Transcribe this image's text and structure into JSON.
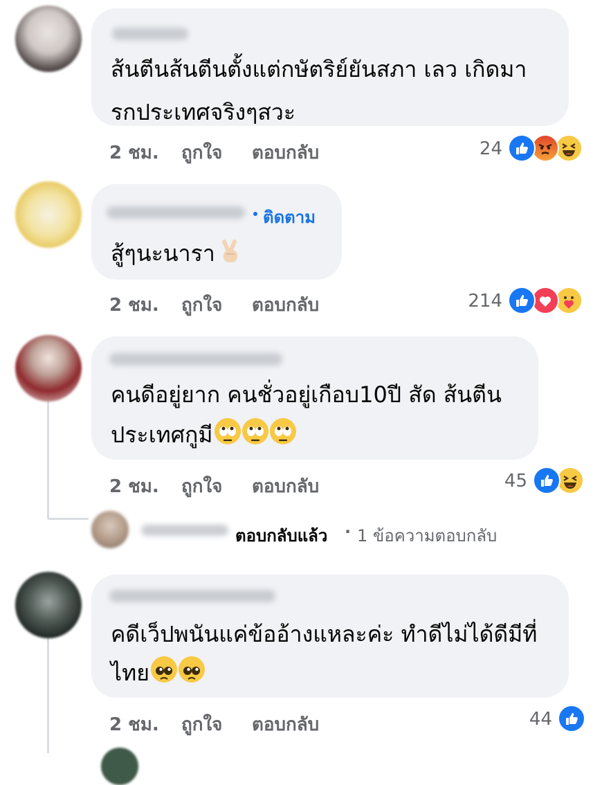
{
  "comments": [
    {
      "text_line1": "ส้นตีนส้นตีนตั้งแต่กษัตริย์ยันสภา เลว เกิดมา",
      "text_line2": "รกประเทศจริงๆสวะ",
      "time": "2 ชม.",
      "like_label": "ถูกใจ",
      "reply_label": "ตอบกลับ",
      "reaction_count": "24",
      "reactions": [
        "like-icon",
        "angry-icon",
        "haha-icon"
      ]
    },
    {
      "follow_label": "ติดตาม",
      "text_line1": "สู้ๆนะนารา",
      "emojis": [
        "victory-hand-icon"
      ],
      "time": "2 ชม.",
      "like_label": "ถูกใจ",
      "reply_label": "ตอบกลับ",
      "reaction_count": "214",
      "reactions": [
        "like-icon",
        "love-icon",
        "care-icon"
      ]
    },
    {
      "text_line1": "คนดีอยู่ยาก คนชั่วอยู่เกือบ10ปี สัด ส้นตีน",
      "text_line2": "ประเทศกูมี",
      "emojis": [
        "eye-roll-icon",
        "eye-roll-icon",
        "eye-roll-icon"
      ],
      "time": "2 ชม.",
      "like_label": "ถูกใจ",
      "reply_label": "ตอบกลับ",
      "reaction_count": "45",
      "reactions": [
        "like-icon",
        "haha-icon"
      ],
      "replies_summary": {
        "replied_label": "ตอบกลับแล้ว",
        "separator": "·",
        "count_label": "1 ข้อความตอบกลับ"
      }
    },
    {
      "text_line1": "คดีเว็ปพนันแค่ข้ออ้างแหละค่ะ ทำดีไม่ได้ดีมีที่",
      "text_line2": "ไทย",
      "emojis": [
        "pleading-face-icon",
        "pleading-face-icon"
      ],
      "time": "2 ชม.",
      "like_label": "ถูกใจ",
      "reply_label": "ตอบกลับ",
      "reaction_count": "44",
      "reactions": [
        "like-icon"
      ]
    }
  ],
  "colors": {
    "bubble": "#f0f2f5",
    "meta_text": "#65676b",
    "link_blue": "#1b74e4",
    "like_blue": "#1877f2",
    "love_red": "#f33e58",
    "emoji_yellow": "#f7c945"
  }
}
